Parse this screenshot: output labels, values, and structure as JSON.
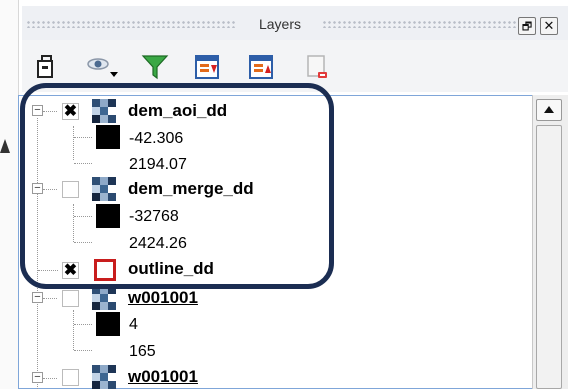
{
  "panel": {
    "title": "Layers",
    "restore_glyph": "🗗",
    "close_glyph": "✕"
  },
  "toolbar": {
    "buttons": [
      {
        "icon": "add-group-icon"
      },
      {
        "icon": "visibility-eye-icon"
      },
      {
        "icon": "filter-funnel-icon"
      },
      {
        "icon": "expand-all-icon"
      },
      {
        "icon": "collapse-all-icon"
      },
      {
        "icon": "remove-layer-icon"
      }
    ]
  },
  "layers": [
    {
      "name": "dem_aoi_dd",
      "checked": true,
      "type": "raster",
      "min": "-42.306",
      "max": "2194.07"
    },
    {
      "name": "dem_merge_dd",
      "checked": false,
      "type": "raster",
      "min": "-32768",
      "max": "2424.26"
    },
    {
      "name": "outline_dd",
      "checked": true,
      "type": "polygon"
    },
    {
      "name": "w001001",
      "checked": false,
      "type": "raster",
      "min": "4",
      "max": "165"
    },
    {
      "name": "w001001",
      "checked": false,
      "type": "raster"
    }
  ],
  "glyphs": {
    "check": "✖",
    "expand": "−"
  },
  "colors": {
    "highlight": "#1b2d52",
    "polygon_outline": "#c81d1d",
    "tree_border": "#7fa6d9"
  }
}
